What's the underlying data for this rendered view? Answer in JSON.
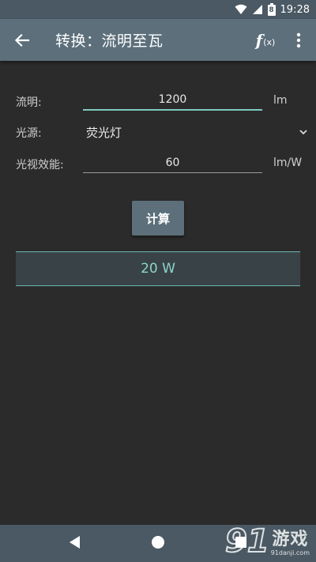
{
  "status_bar": {
    "time": "19:28",
    "battery_label": "8"
  },
  "app_bar": {
    "title": "转换：流明至瓦",
    "fx_main": "f",
    "fx_sub": "(x)"
  },
  "form": {
    "lumens": {
      "label": "流明:",
      "value": "1200",
      "unit": "lm"
    },
    "light_source": {
      "label": "光源:",
      "value": "荧光灯"
    },
    "efficacy": {
      "label": "光视效能:",
      "value": "60",
      "unit": "lm/W"
    }
  },
  "calculate_label": "计算",
  "result": "20 W",
  "watermark": {
    "number": "91",
    "text": "游戏",
    "sub": "91danji.com"
  },
  "colors": {
    "accent": "#7fc9bf",
    "app_bar": "#5c6f7b",
    "background": "#2b2b2b"
  }
}
